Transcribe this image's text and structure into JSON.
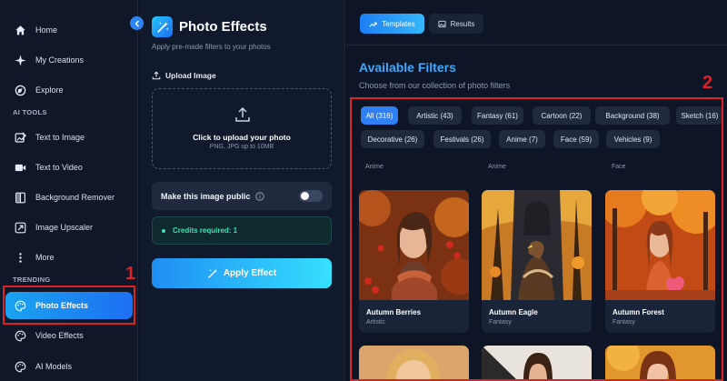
{
  "sidebar": {
    "nav": [
      {
        "label": "Home",
        "icon": "home-icon"
      },
      {
        "label": "My Creations",
        "icon": "sparkle-icon"
      },
      {
        "label": "Explore",
        "icon": "globe-icon"
      }
    ],
    "ai_tools_label": "AI TOOLS",
    "tools": [
      {
        "label": "Text to Image",
        "icon": "image-edit-icon"
      },
      {
        "label": "Text to Video",
        "icon": "video-icon"
      },
      {
        "label": "Background Remover",
        "icon": "layers-icon"
      },
      {
        "label": "Image Upscaler",
        "icon": "upscale-icon"
      },
      {
        "label": "More",
        "icon": "more-icon"
      }
    ],
    "trending_label": "TRENDING",
    "trending": [
      {
        "label": "Photo Effects",
        "icon": "palette-icon",
        "active": true
      },
      {
        "label": "Video Effects",
        "icon": "palette-icon"
      },
      {
        "label": "AI Models",
        "icon": "palette-icon"
      }
    ]
  },
  "middle": {
    "title": "Photo Effects",
    "subtitle": "Apply pre-made filters to your photos",
    "upload_label": "Upload Image",
    "drop_main": "Click to upload your photo",
    "drop_sub": "PNG, JPG up to 10MB",
    "public_label": "Make this image public",
    "public_toggle": false,
    "credits": "Credits required: 1",
    "apply_label": "Apply Effect"
  },
  "right": {
    "tabs": [
      {
        "label": "Templates",
        "active": true
      },
      {
        "label": "Results",
        "active": false
      }
    ],
    "title": "Available Filters",
    "subtitle": "Choose from our collection of photo filters",
    "chips_row1": [
      "All (316)",
      "Artistic (43)",
      "Fantasy (61)",
      "Cartoon (22)",
      "Background (38)",
      "Sketch (16)"
    ],
    "chips_row2": [
      "Decorative (26)",
      "Festivals (26)",
      "Anime (7)",
      "Face (59)",
      "Vehicles (9)"
    ],
    "prev_captions": [
      "Anime",
      "Anime",
      "Face"
    ],
    "cards": [
      {
        "name": "Autumn Berries",
        "category": "Artistic"
      },
      {
        "name": "Autumn Eagle",
        "category": "Fantasy"
      },
      {
        "name": "Autumn Forest",
        "category": "Fantasy"
      }
    ]
  },
  "annotations": {
    "label_1": "1",
    "label_2": "2"
  },
  "colors": {
    "accent": "#2f80f4",
    "annotation_red": "#d9222a",
    "title_blue": "#3aa9ff",
    "credits_green": "#3fe0b0"
  }
}
